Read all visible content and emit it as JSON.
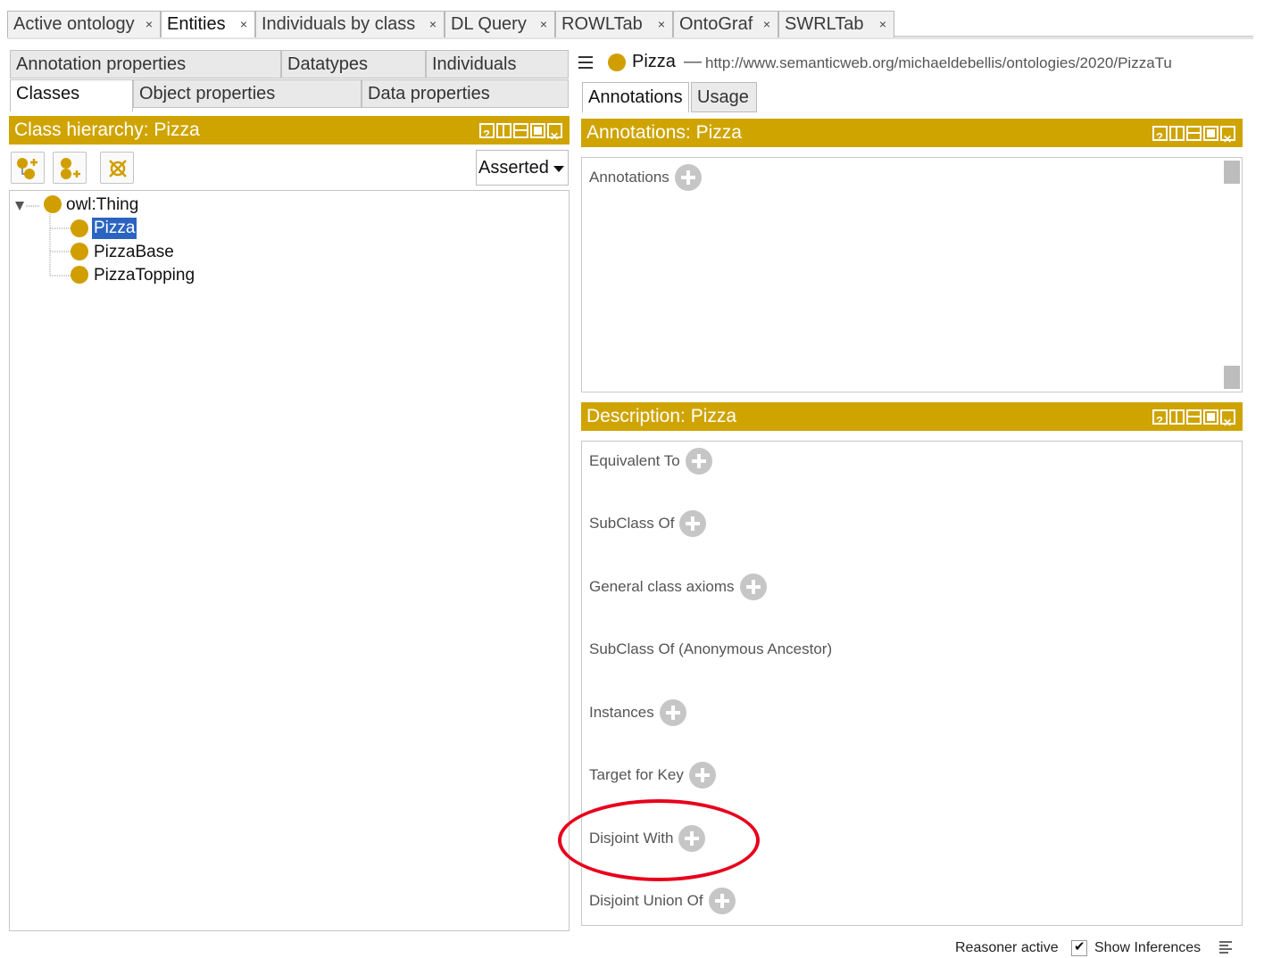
{
  "top_tabs": [
    {
      "label": "Active ontology",
      "close": "×"
    },
    {
      "label": "Entities",
      "close": "×"
    },
    {
      "label": "Individuals by class",
      "close": "×"
    },
    {
      "label": "DL Query",
      "close": "×"
    },
    {
      "label": "ROWLTab",
      "close": "×"
    },
    {
      "label": "OntoGraf",
      "close": "×"
    },
    {
      "label": "SWRLTab",
      "close": "×"
    }
  ],
  "left_tabs": {
    "row1": [
      "Annotation properties",
      "Datatypes",
      "Individuals"
    ],
    "row2": [
      "Classes",
      "Object properties",
      "Data properties"
    ]
  },
  "class_hierarchy": {
    "title": "Class hierarchy: Pizza",
    "view_mode": "Asserted",
    "tree": {
      "root": "owl:Thing",
      "children": [
        "Pizza",
        "PizzaBase",
        "PizzaTopping"
      ],
      "selected": "Pizza"
    }
  },
  "entity": {
    "name": "Pizza",
    "separator": "—",
    "iri": "http://www.semanticweb.org/michaeldebellis/ontologies/2020/PizzaTu"
  },
  "right_tabs": [
    "Annotations",
    "Usage"
  ],
  "annotations_panel": {
    "title": "Annotations: Pizza",
    "section_label": "Annotations"
  },
  "description_panel": {
    "title": "Description: Pizza",
    "sections": [
      "Equivalent To",
      "SubClass Of",
      "General class axioms",
      "SubClass Of (Anonymous Ancestor)",
      "Instances",
      "Target for Key",
      "Disjoint With",
      "Disjoint Union Of"
    ]
  },
  "status_bar": {
    "reasoner": "Reasoner active",
    "show_inferences": "Show Inferences",
    "show_inferences_checked": true
  },
  "colors": {
    "header_gold": "#cfa400",
    "class_dot": "#d19e00",
    "selection": "#2b64c0",
    "highlight_circle": "#e8001c"
  }
}
